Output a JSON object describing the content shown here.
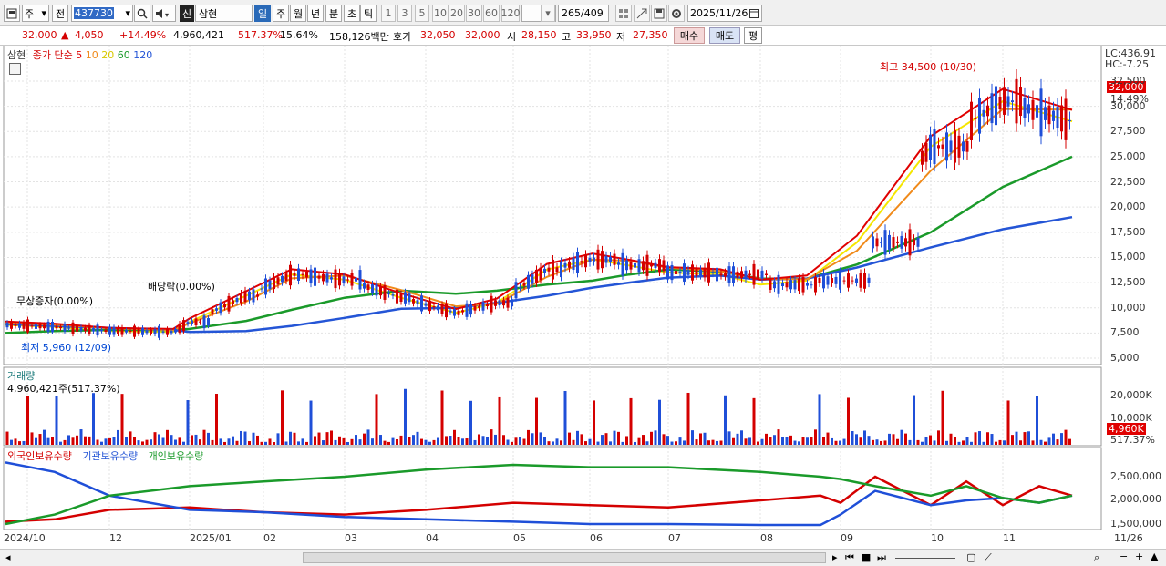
{
  "toolbar": {
    "market": "주",
    "range": "전",
    "code": "437730",
    "stock_name": "삼현",
    "stock_badge": "신",
    "periods": [
      "일",
      "주",
      "월",
      "년",
      "분",
      "초",
      "틱"
    ],
    "intervals": [
      "1",
      "3",
      "5",
      "10",
      "20",
      "30",
      "60",
      "120"
    ],
    "count_value": "265",
    "count_total": "/409",
    "date": "2025/11/26"
  },
  "quote": {
    "price": "32,000",
    "change": "4,050",
    "change_pct": "+14.49%",
    "volume": "4,960,421",
    "volume_ratio": "517.37%",
    "turnover": "15.64%",
    "amount": "158,126백만",
    "bid_label": "호가",
    "bid": "32,050",
    "ask": "32,000",
    "open_label": "시",
    "open": "28,150",
    "high_label": "고",
    "high": "33,950",
    "low_label": "저",
    "low": "27,350",
    "buy_label": "매수",
    "sell_label": "매도",
    "eval_label": "평"
  },
  "price_panel": {
    "name": "삼현",
    "legend_prefix": "종가 단순",
    "ma_labels": [
      "5",
      "10",
      "20",
      "60",
      "120"
    ],
    "lc": "LC:436.91",
    "hc": "HC:-7.25",
    "price_tag": "32,000",
    "pct_tag": "14.49%",
    "high_note": "최고 34,500 (10/30)",
    "low_note": "최저 5,960 (12/09)",
    "event1": "무상증자(0.00%)",
    "event2": "배당락(0.00%)",
    "y_ticks": [
      "32,500",
      "30,000",
      "27,500",
      "25,000",
      "22,500",
      "20,000",
      "17,500",
      "15,000",
      "12,500",
      "10,000",
      "7,500",
      "5,000"
    ]
  },
  "volume_panel": {
    "title": "거래량",
    "value": "4,960,421주(517.37%)",
    "y_ticks": [
      "20,000K",
      "10,000K"
    ],
    "tag": "4,960K",
    "tag_pct": "517.37%"
  },
  "holding_panel": {
    "legend": [
      "외국인보유수량",
      "기관보유수량",
      "개인보유수량"
    ],
    "y_ticks": [
      "2,500,000",
      "2,000,000",
      "1,500,000"
    ]
  },
  "x_axis": {
    "labels": [
      "2024/10",
      "12",
      "2025/01",
      "02",
      "03",
      "04",
      "05",
      "06",
      "07",
      "08",
      "09",
      "10",
      "11",
      "11/26"
    ]
  },
  "colors": {
    "up": "#d40000",
    "down": "#1f4fd8",
    "ma5": "#e00000",
    "ma10": "#f08a1a",
    "ma20": "#f5e600",
    "ma60": "#1a9a2a",
    "ma120": "#2455d6"
  },
  "chart_data": {
    "type": "line",
    "title": "",
    "series": [
      {
        "name": "20",
        "values": [
          8300,
          8100,
          7700,
          7600,
          8600,
          11200,
          13300,
          12800,
          11000,
          9500,
          10500,
          13800,
          14800,
          14200,
          13500,
          13300,
          12300,
          12700,
          16500,
          26000,
          30500,
          28500
        ]
      },
      {
        "name": "60",
        "values": [
          7500,
          7700,
          7800,
          7800,
          7900,
          8700,
          9800,
          11000,
          11700,
          11400,
          11700,
          12300,
          12700,
          13300,
          13800,
          13600,
          12900,
          12900,
          14300,
          17500,
          22000,
          25000
        ]
      },
      {
        "name": "120",
        "values": [
          8400,
          8200,
          8000,
          7800,
          7600,
          7700,
          8200,
          9000,
          9900,
          10000,
          10500,
          11200,
          12000,
          12500,
          13000,
          13200,
          12800,
          12900,
          14000,
          16000,
          17800,
          19000
        ]
      }
    ],
    "x": [
      "2024/10",
      "11",
      "12",
      "2025/01",
      "01",
      "02",
      "03",
      "03",
      "04",
      "04",
      "05",
      "05",
      "06",
      "06",
      "07",
      "07",
      "08",
      "08",
      "09",
      "10",
      "10",
      "11/26"
    ],
    "ylabel": "",
    "ylim": [
      5000,
      35000
    ]
  }
}
